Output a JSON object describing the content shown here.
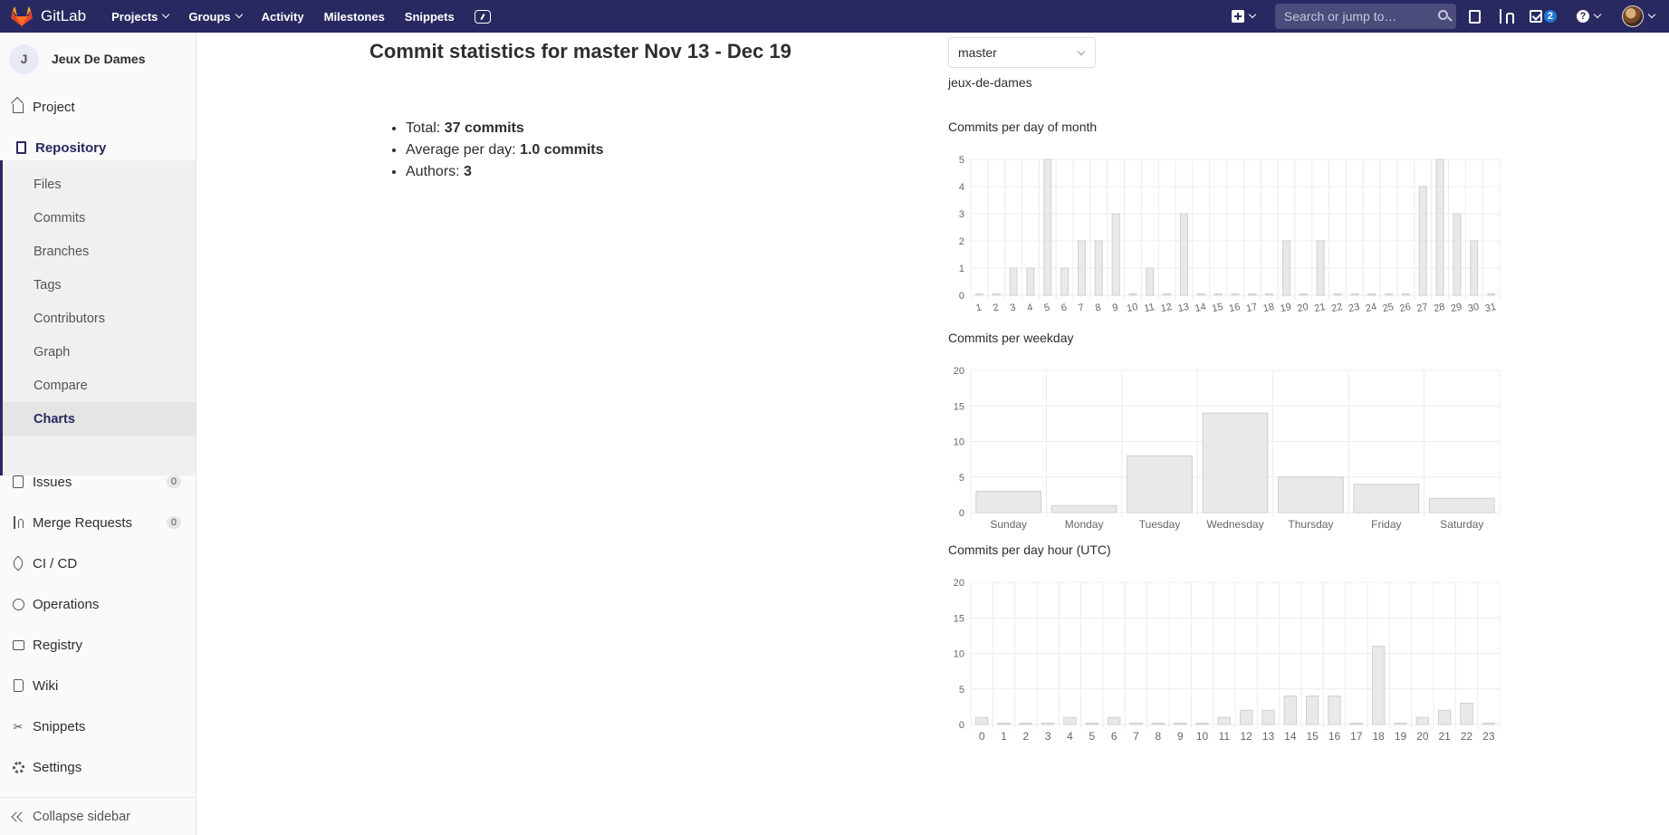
{
  "navbar": {
    "brand": "GitLab",
    "links": [
      {
        "label": "Projects",
        "dropdown": true
      },
      {
        "label": "Groups",
        "dropdown": true
      },
      {
        "label": "Activity",
        "dropdown": false
      },
      {
        "label": "Milestones",
        "dropdown": false
      },
      {
        "label": "Snippets",
        "dropdown": false
      }
    ],
    "search_placeholder": "Search or jump to…",
    "todos_count": "2",
    "accent": "#292961"
  },
  "sidebar": {
    "project_initial": "J",
    "project_name": "Jeux De Dames",
    "project_label": "Project",
    "repository_label": "Repository",
    "repo_items": [
      "Files",
      "Commits",
      "Branches",
      "Tags",
      "Contributors",
      "Graph",
      "Compare",
      "Charts"
    ],
    "active_item": "Charts",
    "issues_label": "Issues",
    "issues_count": "0",
    "mr_label": "Merge Requests",
    "mr_count": "0",
    "cicd_label": "CI / CD",
    "operations_label": "Operations",
    "registry_label": "Registry",
    "wiki_label": "Wiki",
    "snippets_label": "Snippets",
    "settings_label": "Settings",
    "collapse_label": "Collapse sidebar"
  },
  "main": {
    "title": "Commit statistics for master Nov 13 - Dec 19",
    "total_label": "Total:",
    "total_value": "37 commits",
    "avg_label": "Average per day:",
    "avg_value": "1.0 commits",
    "authors_label": "Authors:",
    "authors_value": "3",
    "branch": "master",
    "project_path": "jeux-de-dames"
  },
  "chart_data": [
    {
      "type": "bar",
      "title": "Commits per day of month",
      "categories": [
        "1",
        "2",
        "3",
        "4",
        "5",
        "6",
        "7",
        "8",
        "9",
        "10",
        "11",
        "12",
        "13",
        "14",
        "15",
        "16",
        "17",
        "18",
        "19",
        "20",
        "21",
        "22",
        "23",
        "24",
        "25",
        "26",
        "27",
        "28",
        "29",
        "30",
        "31"
      ],
      "values": [
        0,
        0,
        1,
        1,
        5,
        1,
        2,
        2,
        3,
        0,
        1,
        0,
        3,
        0,
        0,
        0,
        0,
        0,
        2,
        0,
        2,
        0,
        0,
        0,
        0,
        0,
        4,
        5,
        3,
        2,
        0
      ],
      "ylim": [
        0,
        5
      ],
      "yticks": [
        0,
        1,
        2,
        3,
        4,
        5
      ],
      "grid": true
    },
    {
      "type": "bar",
      "title": "Commits per weekday",
      "categories": [
        "Sunday",
        "Monday",
        "Tuesday",
        "Wednesday",
        "Thursday",
        "Friday",
        "Saturday"
      ],
      "values": [
        3,
        1,
        8,
        14,
        5,
        4,
        2
      ],
      "ylim": [
        0,
        20
      ],
      "yticks": [
        0,
        5,
        10,
        15,
        20
      ],
      "grid": true
    },
    {
      "type": "bar",
      "title": "Commits per day hour (UTC)",
      "categories": [
        "0",
        "1",
        "2",
        "3",
        "4",
        "5",
        "6",
        "7",
        "8",
        "9",
        "10",
        "11",
        "12",
        "13",
        "14",
        "15",
        "16",
        "17",
        "18",
        "19",
        "20",
        "21",
        "22",
        "23"
      ],
      "values": [
        1,
        0,
        0,
        0,
        1,
        0,
        1,
        0,
        0,
        0,
        0,
        1,
        2,
        2,
        4,
        4,
        4,
        0,
        11,
        0,
        1,
        2,
        3,
        0
      ],
      "ylim": [
        0,
        20
      ],
      "yticks": [
        0,
        5,
        10,
        15,
        20
      ],
      "grid": true
    }
  ]
}
